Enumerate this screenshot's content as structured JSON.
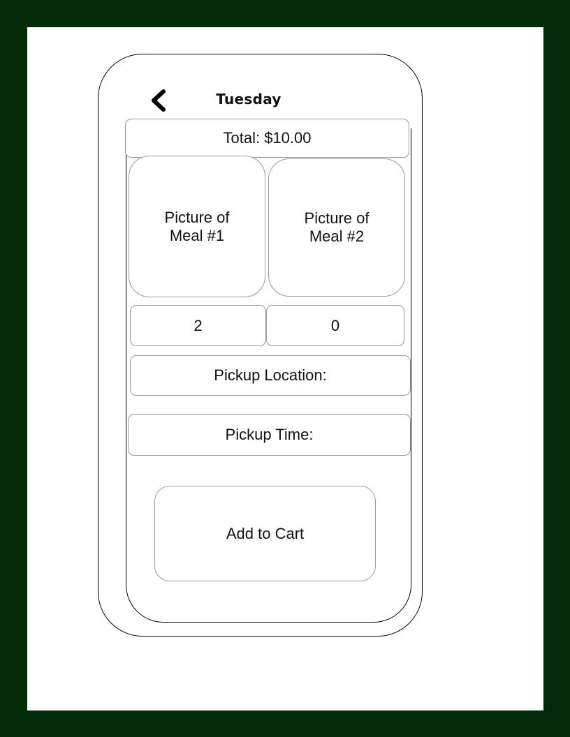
{
  "header": {
    "day": "Tuesday",
    "back_icon": "chevron-left-icon"
  },
  "order": {
    "total_label": "Total: $10.00"
  },
  "meals": [
    {
      "picture_label": "Picture of Meal #1",
      "quantity": "2"
    },
    {
      "picture_label": "Picture of Meal #2",
      "quantity": "0"
    }
  ],
  "pickup": {
    "location_label": "Pickup Location:",
    "time_label": "Pickup Time:"
  },
  "actions": {
    "add_to_cart_label": "Add to Cart"
  },
  "colors": {
    "frame": "#002b06",
    "sheet": "#ffffff",
    "outline": "#000000",
    "box_border": "#9a9a9a"
  }
}
